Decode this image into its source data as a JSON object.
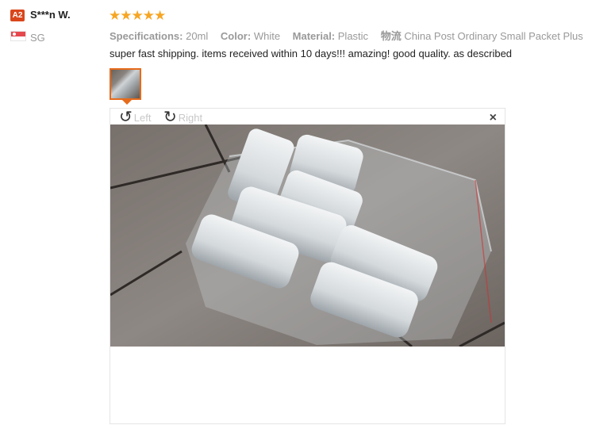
{
  "user": {
    "level_badge": "A2",
    "name": "S***n W.",
    "country": "SG"
  },
  "review": {
    "rating": 5,
    "stars_text": "★★★★★",
    "specs": [
      {
        "label": "Specifications:",
        "value": "20ml"
      },
      {
        "label": "Color:",
        "value": "White"
      },
      {
        "label": "Material:",
        "value": "Plastic"
      },
      {
        "label": "物流",
        "value": "China Post Ordinary Small Packet Plus"
      }
    ],
    "text": "super fast shipping. items received within 10 days!!! amazing! good quality. as described"
  },
  "viewer": {
    "rotate_left_label": "Left",
    "rotate_right_label": "Right",
    "close_symbol": "×"
  },
  "colors": {
    "accent": "#e66b1b",
    "star": "#f6a623",
    "badge": "#d9461b"
  }
}
